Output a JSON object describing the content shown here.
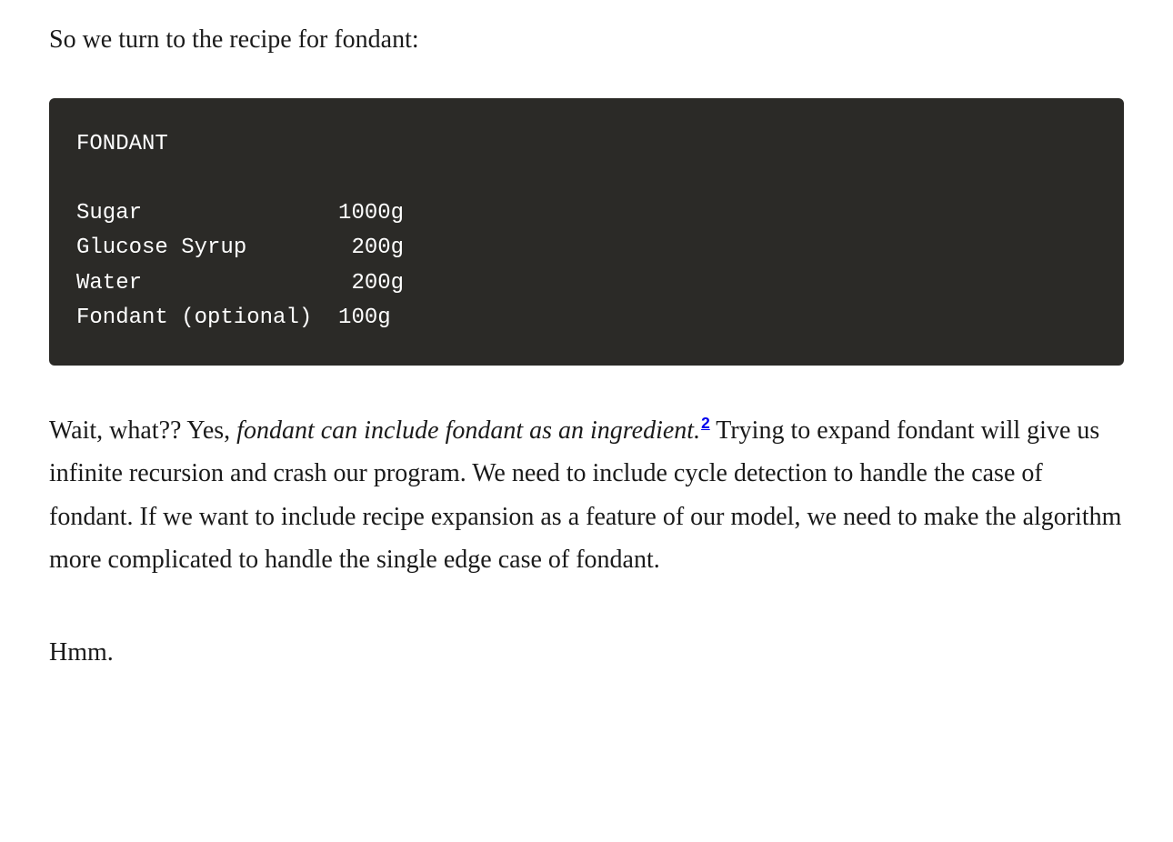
{
  "intro": "So we turn to the recipe for fondant:",
  "code": {
    "title": "FONDANT",
    "lines": [
      "Sugar               1000g",
      "Glucose Syrup        200g",
      "Water                200g",
      "Fondant (optional)  100g"
    ]
  },
  "body": {
    "lead": "Wait, what?? Yes, ",
    "emphasis": "fondant can include fondant as an ingredient.",
    "footnote": "2",
    "rest": " Trying to expand fondant will give us infinite recursion and crash our program. We need to include cycle detection to handle the case of fondant. If we want to include recipe expansion as a feature of our model, we need to make the algorithm more complicated to handle the single edge case of fondant."
  },
  "final": "Hmm."
}
